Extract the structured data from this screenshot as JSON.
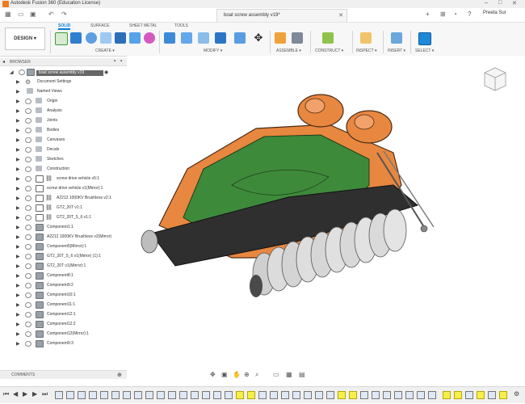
{
  "titlebar": {
    "title": "Autodesk Fusion 360 (Education License)"
  },
  "document": {
    "tab_label": "boat screw assembly v19*"
  },
  "user": {
    "name": "Preeta Sur"
  },
  "workspace": {
    "design_label": "DESIGN ▾"
  },
  "ribbon": {
    "tabs": [
      {
        "label": "SOLID"
      },
      {
        "label": "SURFACE"
      },
      {
        "label": "SHEET METAL"
      },
      {
        "label": "TOOLS"
      }
    ],
    "groups": {
      "create": "CREATE ▾",
      "modify": "MODIFY ▾",
      "assemble": "ASSEMBLE ▾",
      "construct": "CONSTRUCT ▾",
      "inspect": "INSPECT ▾",
      "insert": "INSERT ▾",
      "select": "SELECT ▾"
    }
  },
  "browser": {
    "title": "BROWSER",
    "root": "boat screw assembly v19",
    "items": [
      {
        "label": "Document Settings"
      },
      {
        "label": "Named Views"
      },
      {
        "label": "Origin"
      },
      {
        "label": "Analysis"
      },
      {
        "label": "Joints"
      },
      {
        "label": "Bodies"
      },
      {
        "label": "Canvases"
      },
      {
        "label": "Decals"
      },
      {
        "label": "Sketches"
      },
      {
        "label": "Construction"
      },
      {
        "label": "screw drive vehicle v5:1"
      },
      {
        "label": "screw drive vehicle v1(Mirror):1"
      },
      {
        "label": "A2212 1000KV Brushless v2:1"
      },
      {
        "label": "GT2_20T v1:1"
      },
      {
        "label": "GT2_20T_5_6 v1:1"
      },
      {
        "label": "Component1:1"
      },
      {
        "label": "A2212 1000KV Brushless v2(Mirror)"
      },
      {
        "label": "Component5(Mirror):1"
      },
      {
        "label": "GT2_20T_5_6 v1(Mirror) (1):1"
      },
      {
        "label": "GT2_20T v1(Mirror):1"
      },
      {
        "label": "Component8:1"
      },
      {
        "label": "Component9:2"
      },
      {
        "label": "Component10:1"
      },
      {
        "label": "Component11:1"
      },
      {
        "label": "Component12:1"
      },
      {
        "label": "Component12:2"
      },
      {
        "label": "Component12(Mirror):1"
      },
      {
        "label": "Component9:3"
      }
    ]
  },
  "comments": {
    "title": "COMMENTS"
  },
  "colors": {
    "orange": "#e8873f",
    "green": "#3e8a3b",
    "accent": "#0a7bd6",
    "dark": "#2f2f2f"
  }
}
